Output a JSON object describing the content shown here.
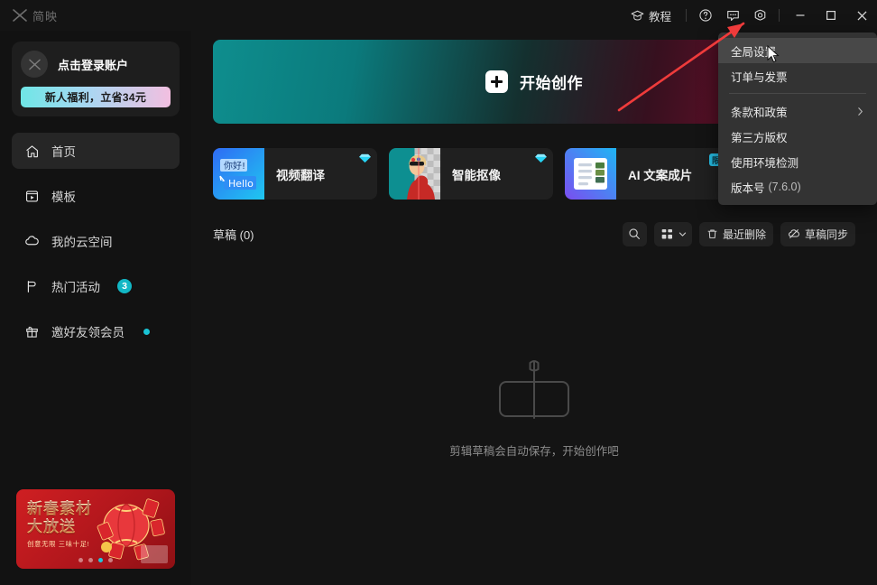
{
  "app": {
    "logo_text": "简映",
    "logo_icon": "jianying-logo-icon"
  },
  "titlebar": {
    "tutorial_label": "教程",
    "tutorial_icon": "graduation-cap-icon",
    "help_icon": "question-circle-icon",
    "feedback_icon": "chat-bubble-icon",
    "settings_icon": "gear-icon",
    "minimize_icon": "minimize-icon",
    "maximize_icon": "maximize-icon",
    "close_icon": "close-icon"
  },
  "sidebar": {
    "account": {
      "login_label": "点击登录账户",
      "avatar_icon": "default-avatar-icon",
      "promo_label": "新人福利，立省34元"
    },
    "items": [
      {
        "label": "首页",
        "icon": "home-icon",
        "active": true,
        "badge": "",
        "dot": false
      },
      {
        "label": "模板",
        "icon": "template-icon",
        "active": false,
        "badge": "",
        "dot": false
      },
      {
        "label": "我的云空间",
        "icon": "cloud-icon",
        "active": false,
        "badge": "",
        "dot": false
      },
      {
        "label": "热门活动",
        "icon": "flag-icon",
        "active": false,
        "badge": "3",
        "dot": false
      },
      {
        "label": "邀好友领会员",
        "icon": "gift-icon",
        "active": false,
        "badge": "",
        "dot": true
      }
    ],
    "promo_banner": {
      "title_line1": "新春素材",
      "title_line2": "大放送",
      "subtitle": "创意无限  三味十足!",
      "dots_total": 4,
      "dot_active_index": 2
    }
  },
  "main": {
    "hero": {
      "cta_label": "开始创作",
      "plus_icon": "plus-icon",
      "gradient_start": "#0e8e8e",
      "gradient_end": "#7a1230"
    },
    "cards": [
      {
        "label": "视频翻译",
        "badge": "vip-diamond",
        "badge_text": "",
        "thumb": "hello-translate-thumb"
      },
      {
        "label": "智能抠像",
        "badge": "vip-diamond",
        "badge_text": "",
        "thumb": "portrait-cutout-thumb"
      },
      {
        "label": "AI 文案成片",
        "badge": "limited",
        "badge_text": "限",
        "thumb": "ai-script-thumb"
      }
    ],
    "drafts": {
      "title": "草稿 (0)",
      "search_icon": "search-icon",
      "view_icon": "grid-view-icon",
      "view_chevron_icon": "chevron-down-icon",
      "recently_deleted_label": "最近删除",
      "recently_deleted_icon": "trash-icon",
      "sync_label": "草稿同步",
      "sync_icon": "cloud-sync-icon"
    },
    "empty_state": {
      "icon": "draft-clip-icon",
      "text": "剪辑草稿会自动保存，开始创作吧"
    }
  },
  "menu": {
    "items": [
      {
        "label": "全局设置",
        "highlighted": true,
        "arrow": false,
        "suffix": ""
      },
      {
        "label": "订单与发票",
        "highlighted": false,
        "arrow": false,
        "suffix": ""
      },
      {
        "separator": true
      },
      {
        "label": "条款和政策",
        "highlighted": false,
        "arrow": true,
        "suffix": ""
      },
      {
        "label": "第三方版权",
        "highlighted": false,
        "arrow": false,
        "suffix": ""
      },
      {
        "label": "使用环境检测",
        "highlighted": false,
        "arrow": false,
        "suffix": ""
      },
      {
        "label": "版本号",
        "highlighted": false,
        "arrow": false,
        "suffix": "(7.6.0)"
      }
    ],
    "arrow_icon": "chevron-right-icon"
  },
  "annotation": {
    "arrow_color": "#ef3b3b",
    "cursor_icon": "mouse-pointer-icon"
  }
}
